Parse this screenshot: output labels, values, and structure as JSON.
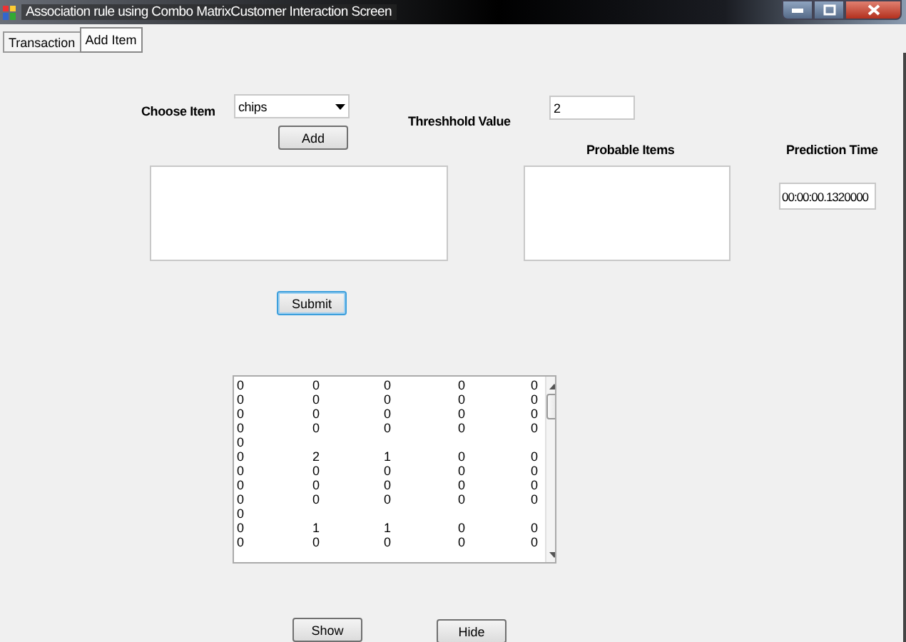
{
  "window": {
    "title": "Association rule using Combo MatrixCustomer Interaction Screen"
  },
  "tabs": [
    {
      "label": "Transaction",
      "selected": false
    },
    {
      "label": "Add Item",
      "selected": true
    }
  ],
  "form": {
    "choose_item": {
      "label": "Choose Item",
      "value": "chips"
    },
    "add_button": {
      "label": "Add",
      "focused": false
    },
    "threshold": {
      "label": "Threshhold Value",
      "value": "2"
    },
    "probable_items": {
      "label": "Probable Items"
    },
    "prediction_time": {
      "label": "Prediction Time",
      "value": "00:00:00.1320000"
    },
    "submit_button": {
      "label": "Submit",
      "focused": true
    },
    "matrix": {
      "rows": [
        [
          "0",
          "0",
          "0",
          "0",
          "0"
        ],
        [
          "0",
          "0",
          "0",
          "0",
          "0"
        ],
        [
          "0",
          "0",
          "0",
          "0",
          "0"
        ],
        [
          "0",
          "0",
          "0",
          "0",
          "0"
        ],
        [
          "0"
        ],
        [
          "0",
          "2",
          "1",
          "0",
          "0"
        ],
        [
          "0",
          "0",
          "0",
          "0",
          "0"
        ],
        [
          "0",
          "0",
          "0",
          "0",
          "0"
        ],
        [
          "0",
          "0",
          "0",
          "0",
          "0"
        ],
        [
          "0"
        ],
        [
          "0",
          "1",
          "1",
          "0",
          "0"
        ],
        [
          "0",
          "0",
          "0",
          "0",
          "0"
        ]
      ]
    },
    "buttons": [
      {
        "label": "Show",
        "focused": false
      },
      {
        "label": "Hide",
        "focused": false
      }
    ]
  }
}
